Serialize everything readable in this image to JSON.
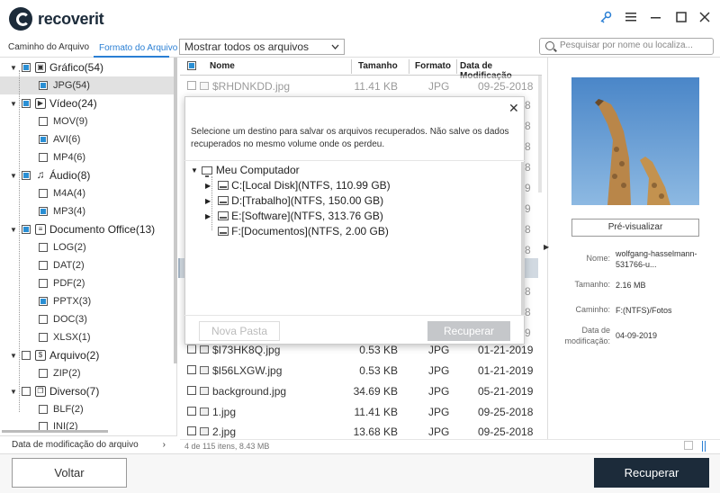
{
  "app": {
    "name": "recoverit"
  },
  "tabs": [
    {
      "label": "Caminho do Arquivo"
    },
    {
      "label": "Formato do Arquivo"
    }
  ],
  "filter": {
    "selected": "Mostrar todos os arquivos"
  },
  "search": {
    "placeholder": "Pesquisar por nome ou localiza..."
  },
  "tree": [
    {
      "label": "Gráfico(54)",
      "icon": "image-icon"
    },
    {
      "label": "JPG(54)"
    },
    {
      "label": "Vídeo(24)",
      "icon": "video-icon"
    },
    {
      "label": "MOV(9)"
    },
    {
      "label": "AVI(6)"
    },
    {
      "label": "MP4(6)"
    },
    {
      "label": "Áudio(8)",
      "icon": "music-icon"
    },
    {
      "label": "M4A(4)"
    },
    {
      "label": "MP3(4)"
    },
    {
      "label": "Documento Office(13)",
      "icon": "document-icon"
    },
    {
      "label": "LOG(2)"
    },
    {
      "label": "DAT(2)"
    },
    {
      "label": "PDF(2)"
    },
    {
      "label": "PPTX(3)"
    },
    {
      "label": "DOC(3)"
    },
    {
      "label": "XLSX(1)"
    },
    {
      "label": "Arquivo(2)",
      "icon": "archive-icon"
    },
    {
      "label": "ZIP(2)"
    },
    {
      "label": "Diverso(7)",
      "icon": "misc-icon"
    },
    {
      "label": "BLF(2)"
    },
    {
      "label": "INI(2)"
    }
  ],
  "sort": {
    "label": "Data de modificação do arquivo"
  },
  "table": {
    "headers": {
      "name": "Nome",
      "size": "Tamanho",
      "format": "Formato",
      "date": "Data de Modificação"
    },
    "rows": [
      {
        "name": "$RHDNKDD.jpg",
        "size": "11.41  KB",
        "format": "JPG",
        "date": "09-25-2018"
      },
      {
        "name": "$I73HK8Q.jpg",
        "size": "0.53  KB",
        "format": "JPG",
        "date": "01-21-2019"
      },
      {
        "name": "$I56LXGW.jpg",
        "size": "0.53  KB",
        "format": "JPG",
        "date": "01-21-2019"
      },
      {
        "name": "background.jpg",
        "size": "34.69  KB",
        "format": "JPG",
        "date": "05-21-2019"
      },
      {
        "name": "1.jpg",
        "size": "11.41  KB",
        "format": "JPG",
        "date": "09-25-2018"
      },
      {
        "name": "2.jpg",
        "size": "13.68  KB",
        "format": "JPG",
        "date": "09-25-2018"
      }
    ],
    "hidden_dates": [
      "8",
      "8",
      "8",
      "8",
      "9",
      "9",
      "8",
      "8",
      "9",
      "8",
      "8",
      "9"
    ]
  },
  "status": {
    "text": "4 de 115 itens, 8.43  MB"
  },
  "preview": {
    "button": "Pré-visualizar",
    "name_key": "Nome:",
    "name_val": "wolfgang-hasselmann-531766-u...",
    "size_key": "Tamanho:",
    "size_val": "2.16  MB",
    "path_key": "Caminho:",
    "path_val": "F:(NTFS)/Fotos",
    "date_key": "Data de modificação:",
    "date_val": "04-09-2019"
  },
  "footer": {
    "back": "Voltar",
    "recover": "Recuperar"
  },
  "dialog": {
    "message": "Selecione um destino para salvar os arquivos recuperados. Não salve os dados recuperados no mesmo volume onde os perdeu.",
    "root": "Meu Computador",
    "drives": [
      {
        "label": "C:[Local Disk](NTFS, 110.99  GB)"
      },
      {
        "label": "D:[Trabalho](NTFS, 150.00  GB)"
      },
      {
        "label": "E:[Software](NTFS, 313.76  GB)"
      },
      {
        "label": "F:[Documentos](NTFS, 2.00  GB)"
      }
    ],
    "new_folder": "Nova Pasta",
    "recover": "Recuperar"
  },
  "colors": {
    "accent": "#2a7fd4",
    "dark": "#1c2b3a",
    "highlight_row": "#a3b3c3"
  }
}
